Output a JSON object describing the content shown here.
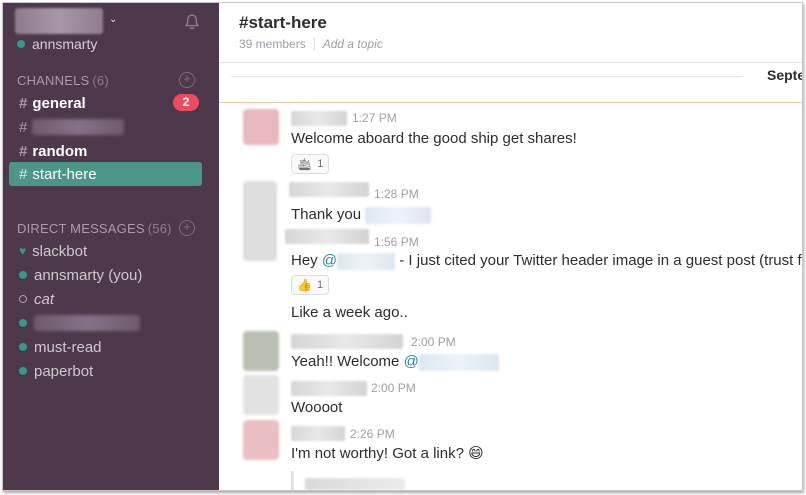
{
  "team": {
    "user": "annsmarty"
  },
  "channels": {
    "heading": "CHANNELS",
    "count": "(6)",
    "items": [
      {
        "hash": "#",
        "label": "general",
        "badge": "2"
      },
      {
        "hash": "#",
        "label": ""
      },
      {
        "hash": "#",
        "label": "random"
      },
      {
        "hash": "#",
        "label": "start-here"
      }
    ]
  },
  "dms": {
    "heading": "DIRECT MESSAGES",
    "count": "(56)",
    "items": [
      {
        "label": "slackbot"
      },
      {
        "label": "annsmarty (you)"
      },
      {
        "label": "cat"
      },
      {
        "label": ""
      },
      {
        "label": "must-read"
      },
      {
        "label": "paperbot"
      }
    ]
  },
  "header": {
    "title": "#start-here",
    "members": "39 members",
    "topic": "Add a topic"
  },
  "day_divider": "Septe",
  "messages": [
    {
      "time": "1:27 PM",
      "text": "Welcome aboard the good ship get shares!",
      "reaction_count": "1"
    },
    {
      "time": "1:28 PM",
      "text": "Thank you"
    },
    {
      "time": "1:56 PM",
      "text_prefix": "Hey ",
      "mention": "@",
      "text_suffix": " - I just cited your Twitter header image in a guest post (trust facto",
      "reaction_count": "1"
    },
    {
      "text": "Like a week ago.."
    },
    {
      "time": "2:00 PM",
      "text": "Yeah!! Welcome ",
      "mention": "@"
    },
    {
      "time": "2:00 PM",
      "text": "Woooot"
    },
    {
      "time": "2:26 PM",
      "text": "I'm not worthy! Got a link? 😄"
    }
  ],
  "colors": {
    "sidebar_bg": "#4d394b",
    "active_channel": "#4c9689",
    "badge": "#eb4d5c",
    "mention": "#2a80b9",
    "presence": "#38978d"
  },
  "icons": {
    "bell": "bell-icon",
    "add_channel": "plus-circle-icon",
    "ship_reaction": "ship-emoji",
    "thumbs_reaction": "thumbs-up-emoji"
  }
}
